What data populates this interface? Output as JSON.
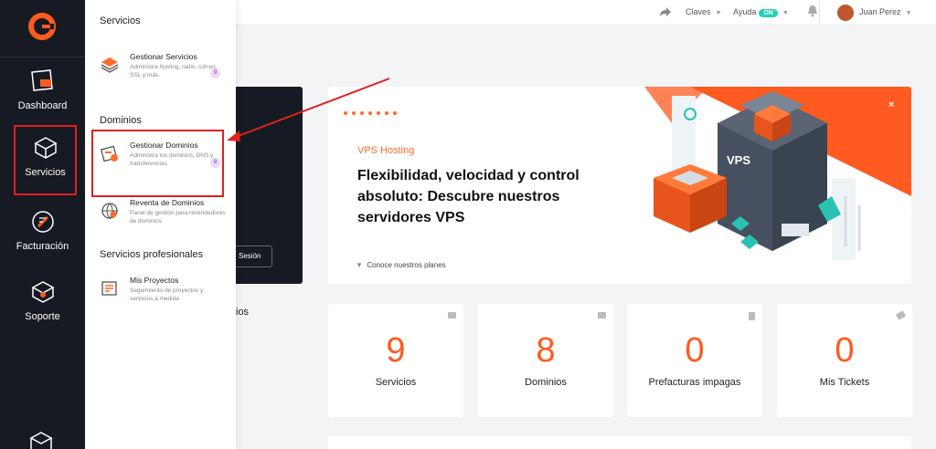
{
  "rail": {
    "items": [
      {
        "label": "Dashboard",
        "icon": "dashboard-icon"
      },
      {
        "label": "Servicios",
        "icon": "box-icon"
      },
      {
        "label": "Facturación",
        "icon": "invoice-icon"
      },
      {
        "label": "Soporte",
        "icon": "support-icon"
      }
    ]
  },
  "topbar": {
    "claves": "Claves",
    "ayuda": "Ayuda",
    "ayuda_badge": "ON",
    "user": "Juan Perez"
  },
  "menu": {
    "sections": [
      {
        "title": "Servicios"
      },
      {
        "title": "Dominios"
      },
      {
        "title": "Servicios profesionales"
      }
    ],
    "items": [
      {
        "title": "Gestionar Servicios",
        "desc": "Administra hosting, radio, correo, SSL y más.",
        "count": "9"
      },
      {
        "title": "Gestionar Dominios",
        "desc": "Administra tus dominios, DNS y transferencias",
        "count": "8"
      },
      {
        "title": "Reventa de Dominios",
        "desc": "Panel de gestión para revendedores de dominios"
      },
      {
        "title": "Mis Proyectos",
        "desc": "Seguimiento de proyectos y servicios a medida"
      }
    ]
  },
  "hidden": {
    "session_label": "Sesión",
    "partial_label": "ios"
  },
  "banner": {
    "kicker": "VPS Hosting",
    "title": "Flexibilidad, velocidad y control absoluto: Descubre nuestros servidores VPS",
    "plans_link": "Conoce nuestros planes",
    "close": "×",
    "art_label": "VPS"
  },
  "stats": [
    {
      "value": "9",
      "label": "Servicios"
    },
    {
      "value": "8",
      "label": "Dominios"
    },
    {
      "value": "0",
      "label": "Prefacturas impagas"
    },
    {
      "value": "0",
      "label": "Mis Tickets"
    }
  ],
  "colors": {
    "accent": "#ff5a1f",
    "rail": "#161a22",
    "highlight": "#e02020",
    "on_badge": "#25d0b8"
  }
}
